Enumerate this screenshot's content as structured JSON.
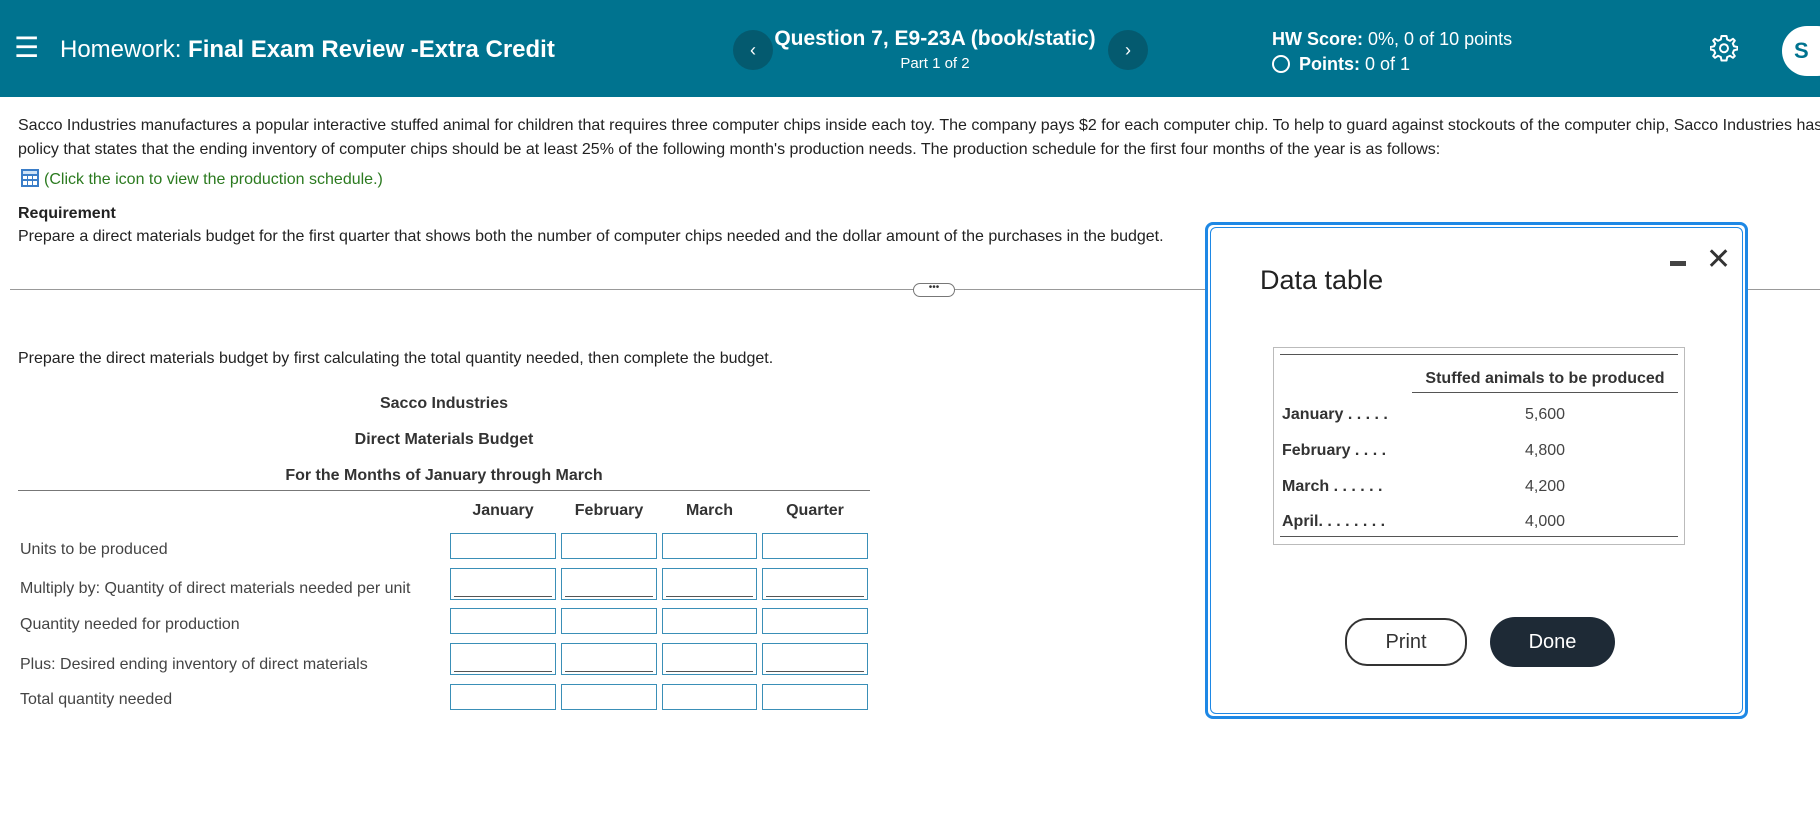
{
  "header": {
    "menu_icon": "hamburger-icon",
    "homework_prefix": "Homework:",
    "homework_title": "Final Exam Review -Extra Credit",
    "prev_label": "‹",
    "next_label": "›",
    "question_title": "Question 7, E9-23A (book/static)",
    "question_part": "Part 1 of 2",
    "hw_score_label": "HW Score:",
    "hw_score_value": "0%, 0 of 10 points",
    "points_label": "Points:",
    "points_value": "0 of 1",
    "settings_icon": "gear-icon",
    "avatar_text": "S",
    "bg_color": "#00738f"
  },
  "problem": {
    "line1": "Sacco Industries manufactures a popular interactive stuffed animal for children that requires three computer chips inside each toy.  The company pays $2 for each computer chip. To help to guard against stockouts of the computer chip, Sacco Industries has a",
    "line2": "policy that states that the ending inventory of computer chips should be at least 25% of the following month's production needs. The production schedule for the first four months of the year is as follows:",
    "link_text": "(Click the icon to view the production schedule.)",
    "requirement_label": "Requirement",
    "requirement_text": "Prepare a direct materials budget for the first quarter that shows both the number of computer chips needed and the dollar amount of the purchases in the budget.",
    "instruction": "Prepare the direct materials budget by first calculating the total quantity needed, then complete the budget."
  },
  "budget": {
    "company": "Sacco Industries",
    "title": "Direct Materials Budget",
    "period": "For the Months of January through March",
    "columns": [
      "January",
      "February",
      "March",
      "Quarter"
    ],
    "rows": [
      "Units to be produced",
      "Multiply by: Quantity of direct materials needed per unit",
      "Quantity needed for production",
      "Plus: Desired ending inventory of direct materials",
      "Total quantity needed"
    ]
  },
  "dialog": {
    "title": "Data table",
    "column_header": "Stuffed animals to be produced",
    "rows": [
      {
        "month": "January . . . . .",
        "value": "5,600"
      },
      {
        "month": "February . . . .",
        "value": "4,800"
      },
      {
        "month": "March  . . . . . .",
        "value": "4,200"
      },
      {
        "month": "April. . . . . . . .",
        "value": "4,000"
      }
    ],
    "print_label": "Print",
    "done_label": "Done",
    "accent_color": "#1e88e5"
  }
}
